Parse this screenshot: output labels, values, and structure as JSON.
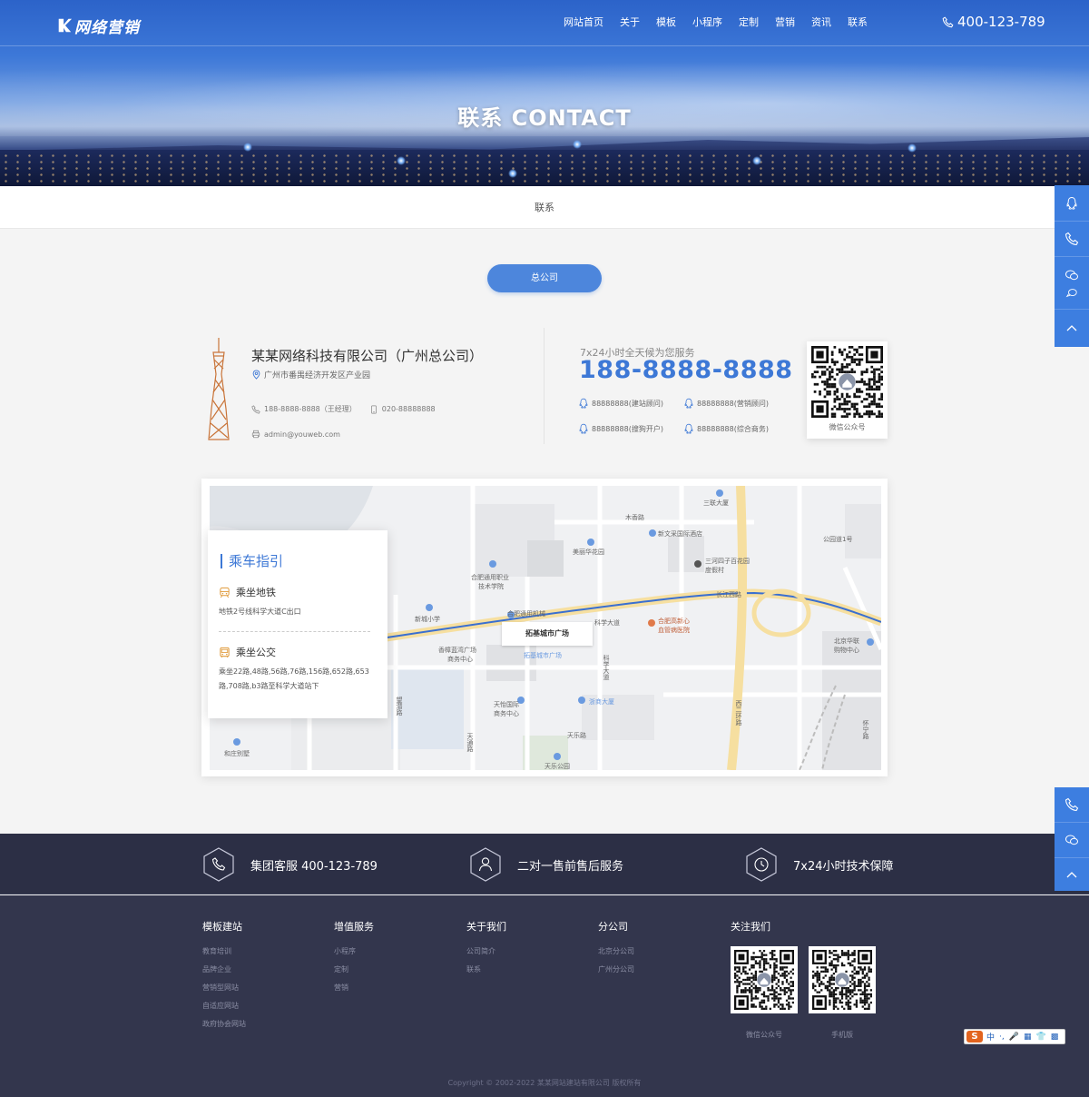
{
  "header": {
    "logo_text": "网络营销",
    "nav": [
      "网站首页",
      "关于",
      "模板",
      "小程序",
      "定制",
      "营销",
      "资讯",
      "联系"
    ],
    "hotline": "400-123-789"
  },
  "banner": {
    "title": "联系  CONTACT"
  },
  "breadcrumb": "联系",
  "tab": "总公司",
  "company": {
    "name": "某某网络科技有限公司（广州总公司）",
    "address": "广州市番禺经济开发区产业园",
    "mobile": "188-8888-8888（王经理）",
    "tel": "020-88888888",
    "email": "admin@youweb.com"
  },
  "service": {
    "label": "7x24小时全天候为您服务",
    "phone": "188-8888-8888",
    "qq": [
      "88888888(建站顾问)",
      "88888888(营销顾问)",
      "88888888(搜狗开户)",
      "88888888(综合商务)"
    ],
    "qr_label": "微信公众号"
  },
  "map": {
    "labels": {
      "l1": "三联大厦",
      "l2": "木香路",
      "l3": "新文采国际酒店",
      "l4": "美丽华花园",
      "l5": "三河四子百花园",
      "l6": "度假村",
      "l7": "公园道1号",
      "l8": "合肥通用职业",
      "l9": "技术学院",
      "l10": "新城小学",
      "l11": "合肥通用机械",
      "l12": "拓基城市广场",
      "l13": "拓基城市广场",
      "l14": "科学大道",
      "l15": "合肥高新心",
      "l16": "血管病医院",
      "l17": "北京华联",
      "l18": "购物中心",
      "l19": "香樟蓝湾广场",
      "l20": "商务中心",
      "l21": "天怡国际",
      "l22": "商务中心",
      "l23": "浙商大厦",
      "l24": "天乐路",
      "l25": "天乐公园",
      "l26": "和庄别墅",
      "l27": "科学大道",
      "l28": "长江西路",
      "l29": "西二环路",
      "l30": "怀宁路",
      "l31": "天通路",
      "l32": "望潜路"
    }
  },
  "guide": {
    "title": "乘车指引",
    "metro_title": "乘坐地铁",
    "metro_text": "地铁2号线科学大道C出口",
    "bus_title": "乘坐公交",
    "bus_text": "乘坐22路,48路,56路,76路,156路,652路,653路,708路,b3路至科学大道站下"
  },
  "strip": {
    "s1": "集团客服 400-123-789",
    "s2": "二对一售前售后服务",
    "s3": "7x24小时技术保障"
  },
  "footer": {
    "cols": [
      {
        "head": "模板建站",
        "links": [
          "教育培训",
          "品牌企业",
          "营销型网站",
          "自适应网站",
          "政府协会网站"
        ]
      },
      {
        "head": "增值服务",
        "links": [
          "小程序",
          "定制",
          "营销"
        ]
      },
      {
        "head": "关于我们",
        "links": [
          "公司简介",
          "联系"
        ]
      },
      {
        "head": "分公司",
        "links": [
          "北京分公司",
          "广州分公司"
        ]
      }
    ],
    "follow_head": "关注我们",
    "qr1_label": "微信公众号",
    "qr2_label": "手机版",
    "copyright": "Copyright © 2002-2022 某某网站建站有限公司 版权所有"
  },
  "ime": {
    "logo": "S",
    "glyphs": [
      "中",
      "·,",
      "🎤",
      "▦",
      "👕",
      "▩"
    ]
  },
  "colors": {
    "accent": "#3d78d6",
    "dark": "#2c2f45",
    "footer": "#33364d"
  }
}
